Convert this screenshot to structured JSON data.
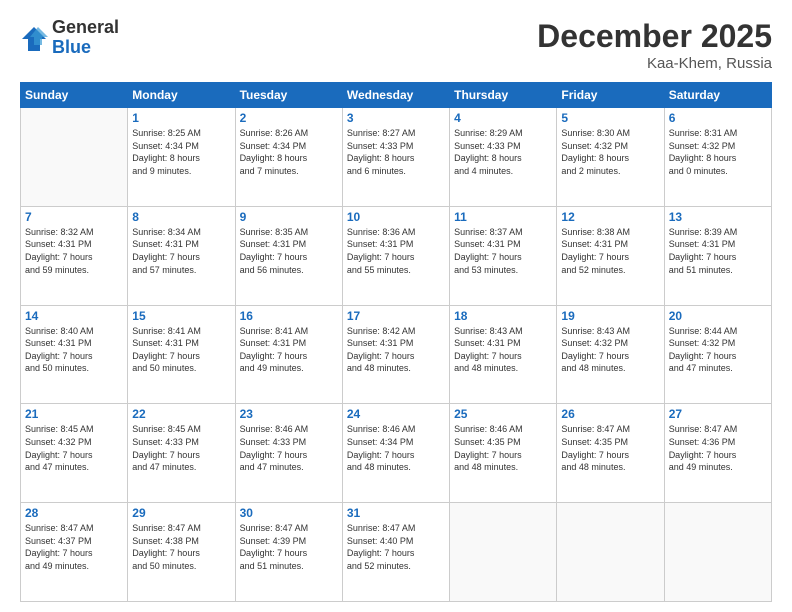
{
  "logo": {
    "general": "General",
    "blue": "Blue"
  },
  "header": {
    "month": "December 2025",
    "location": "Kaa-Khem, Russia"
  },
  "weekdays": [
    "Sunday",
    "Monday",
    "Tuesday",
    "Wednesday",
    "Thursday",
    "Friday",
    "Saturday"
  ],
  "weeks": [
    [
      {
        "day": "",
        "info": ""
      },
      {
        "day": "1",
        "info": "Sunrise: 8:25 AM\nSunset: 4:34 PM\nDaylight: 8 hours\nand 9 minutes."
      },
      {
        "day": "2",
        "info": "Sunrise: 8:26 AM\nSunset: 4:34 PM\nDaylight: 8 hours\nand 7 minutes."
      },
      {
        "day": "3",
        "info": "Sunrise: 8:27 AM\nSunset: 4:33 PM\nDaylight: 8 hours\nand 6 minutes."
      },
      {
        "day": "4",
        "info": "Sunrise: 8:29 AM\nSunset: 4:33 PM\nDaylight: 8 hours\nand 4 minutes."
      },
      {
        "day": "5",
        "info": "Sunrise: 8:30 AM\nSunset: 4:32 PM\nDaylight: 8 hours\nand 2 minutes."
      },
      {
        "day": "6",
        "info": "Sunrise: 8:31 AM\nSunset: 4:32 PM\nDaylight: 8 hours\nand 0 minutes."
      }
    ],
    [
      {
        "day": "7",
        "info": "Sunrise: 8:32 AM\nSunset: 4:31 PM\nDaylight: 7 hours\nand 59 minutes."
      },
      {
        "day": "8",
        "info": "Sunrise: 8:34 AM\nSunset: 4:31 PM\nDaylight: 7 hours\nand 57 minutes."
      },
      {
        "day": "9",
        "info": "Sunrise: 8:35 AM\nSunset: 4:31 PM\nDaylight: 7 hours\nand 56 minutes."
      },
      {
        "day": "10",
        "info": "Sunrise: 8:36 AM\nSunset: 4:31 PM\nDaylight: 7 hours\nand 55 minutes."
      },
      {
        "day": "11",
        "info": "Sunrise: 8:37 AM\nSunset: 4:31 PM\nDaylight: 7 hours\nand 53 minutes."
      },
      {
        "day": "12",
        "info": "Sunrise: 8:38 AM\nSunset: 4:31 PM\nDaylight: 7 hours\nand 52 minutes."
      },
      {
        "day": "13",
        "info": "Sunrise: 8:39 AM\nSunset: 4:31 PM\nDaylight: 7 hours\nand 51 minutes."
      }
    ],
    [
      {
        "day": "14",
        "info": "Sunrise: 8:40 AM\nSunset: 4:31 PM\nDaylight: 7 hours\nand 50 minutes."
      },
      {
        "day": "15",
        "info": "Sunrise: 8:41 AM\nSunset: 4:31 PM\nDaylight: 7 hours\nand 50 minutes."
      },
      {
        "day": "16",
        "info": "Sunrise: 8:41 AM\nSunset: 4:31 PM\nDaylight: 7 hours\nand 49 minutes."
      },
      {
        "day": "17",
        "info": "Sunrise: 8:42 AM\nSunset: 4:31 PM\nDaylight: 7 hours\nand 48 minutes."
      },
      {
        "day": "18",
        "info": "Sunrise: 8:43 AM\nSunset: 4:31 PM\nDaylight: 7 hours\nand 48 minutes."
      },
      {
        "day": "19",
        "info": "Sunrise: 8:43 AM\nSunset: 4:32 PM\nDaylight: 7 hours\nand 48 minutes."
      },
      {
        "day": "20",
        "info": "Sunrise: 8:44 AM\nSunset: 4:32 PM\nDaylight: 7 hours\nand 47 minutes."
      }
    ],
    [
      {
        "day": "21",
        "info": "Sunrise: 8:45 AM\nSunset: 4:32 PM\nDaylight: 7 hours\nand 47 minutes."
      },
      {
        "day": "22",
        "info": "Sunrise: 8:45 AM\nSunset: 4:33 PM\nDaylight: 7 hours\nand 47 minutes."
      },
      {
        "day": "23",
        "info": "Sunrise: 8:46 AM\nSunset: 4:33 PM\nDaylight: 7 hours\nand 47 minutes."
      },
      {
        "day": "24",
        "info": "Sunrise: 8:46 AM\nSunset: 4:34 PM\nDaylight: 7 hours\nand 48 minutes."
      },
      {
        "day": "25",
        "info": "Sunrise: 8:46 AM\nSunset: 4:35 PM\nDaylight: 7 hours\nand 48 minutes."
      },
      {
        "day": "26",
        "info": "Sunrise: 8:47 AM\nSunset: 4:35 PM\nDaylight: 7 hours\nand 48 minutes."
      },
      {
        "day": "27",
        "info": "Sunrise: 8:47 AM\nSunset: 4:36 PM\nDaylight: 7 hours\nand 49 minutes."
      }
    ],
    [
      {
        "day": "28",
        "info": "Sunrise: 8:47 AM\nSunset: 4:37 PM\nDaylight: 7 hours\nand 49 minutes."
      },
      {
        "day": "29",
        "info": "Sunrise: 8:47 AM\nSunset: 4:38 PM\nDaylight: 7 hours\nand 50 minutes."
      },
      {
        "day": "30",
        "info": "Sunrise: 8:47 AM\nSunset: 4:39 PM\nDaylight: 7 hours\nand 51 minutes."
      },
      {
        "day": "31",
        "info": "Sunrise: 8:47 AM\nSunset: 4:40 PM\nDaylight: 7 hours\nand 52 minutes."
      },
      {
        "day": "",
        "info": ""
      },
      {
        "day": "",
        "info": ""
      },
      {
        "day": "",
        "info": ""
      }
    ]
  ]
}
